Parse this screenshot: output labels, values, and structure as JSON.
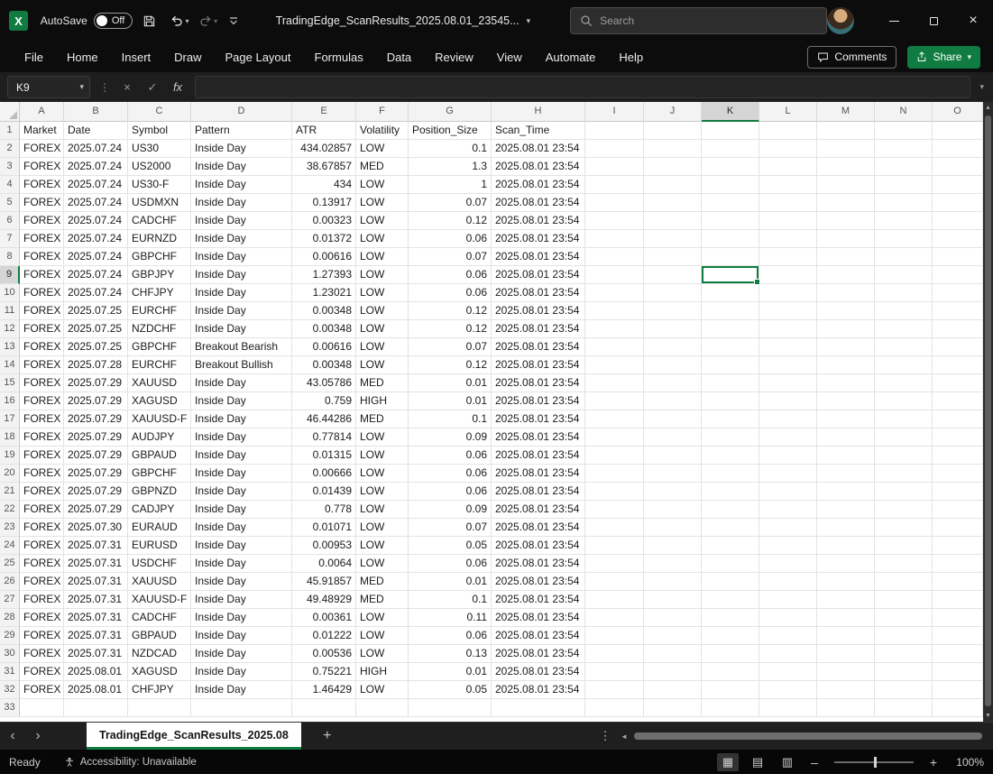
{
  "window": {
    "app": "Excel",
    "autosave_label": "AutoSave",
    "autosave_state": "Off",
    "document_title": "TradingEdge_ScanResults_2025.08.01_23545...",
    "search_placeholder": "Search"
  },
  "ribbon": {
    "tabs": [
      "File",
      "Home",
      "Insert",
      "Draw",
      "Page Layout",
      "Formulas",
      "Data",
      "Review",
      "View",
      "Automate",
      "Help"
    ],
    "comments_label": "Comments",
    "share_label": "Share"
  },
  "formula_bar": {
    "name_box_value": "K9",
    "fx_label": "fx",
    "formula_value": ""
  },
  "grid": {
    "columns": [
      "A",
      "B",
      "C",
      "D",
      "E",
      "F",
      "G",
      "H",
      "I",
      "J",
      "K",
      "L",
      "M",
      "N",
      "O"
    ],
    "selected_cell": "K9",
    "selected_column": "K",
    "selected_row": 9,
    "total_rows": 33,
    "header_row": [
      "Market",
      "Date",
      "Symbol",
      "Pattern",
      "ATR",
      "Volatility",
      "Position_Size",
      "Scan_Time"
    ],
    "rows": [
      [
        "FOREX",
        "2025.07.24",
        "US30",
        "Inside Day",
        "434.02857",
        "LOW",
        "0.1",
        "2025.08.01 23:54"
      ],
      [
        "FOREX",
        "2025.07.24",
        "US2000",
        "Inside Day",
        "38.67857",
        "MED",
        "1.3",
        "2025.08.01 23:54"
      ],
      [
        "FOREX",
        "2025.07.24",
        "US30-F",
        "Inside Day",
        "434",
        "LOW",
        "1",
        "2025.08.01 23:54"
      ],
      [
        "FOREX",
        "2025.07.24",
        "USDMXN",
        "Inside Day",
        "0.13917",
        "LOW",
        "0.07",
        "2025.08.01 23:54"
      ],
      [
        "FOREX",
        "2025.07.24",
        "CADCHF",
        "Inside Day",
        "0.00323",
        "LOW",
        "0.12",
        "2025.08.01 23:54"
      ],
      [
        "FOREX",
        "2025.07.24",
        "EURNZD",
        "Inside Day",
        "0.01372",
        "LOW",
        "0.06",
        "2025.08.01 23:54"
      ],
      [
        "FOREX",
        "2025.07.24",
        "GBPCHF",
        "Inside Day",
        "0.00616",
        "LOW",
        "0.07",
        "2025.08.01 23:54"
      ],
      [
        "FOREX",
        "2025.07.24",
        "GBPJPY",
        "Inside Day",
        "1.27393",
        "LOW",
        "0.06",
        "2025.08.01 23:54"
      ],
      [
        "FOREX",
        "2025.07.24",
        "CHFJPY",
        "Inside Day",
        "1.23021",
        "LOW",
        "0.06",
        "2025.08.01 23:54"
      ],
      [
        "FOREX",
        "2025.07.25",
        "EURCHF",
        "Inside Day",
        "0.00348",
        "LOW",
        "0.12",
        "2025.08.01 23:54"
      ],
      [
        "FOREX",
        "2025.07.25",
        "NZDCHF",
        "Inside Day",
        "0.00348",
        "LOW",
        "0.12",
        "2025.08.01 23:54"
      ],
      [
        "FOREX",
        "2025.07.25",
        "GBPCHF",
        "Breakout Bearish",
        "0.00616",
        "LOW",
        "0.07",
        "2025.08.01 23:54"
      ],
      [
        "FOREX",
        "2025.07.28",
        "EURCHF",
        "Breakout Bullish",
        "0.00348",
        "LOW",
        "0.12",
        "2025.08.01 23:54"
      ],
      [
        "FOREX",
        "2025.07.29",
        "XAUUSD",
        "Inside Day",
        "43.05786",
        "MED",
        "0.01",
        "2025.08.01 23:54"
      ],
      [
        "FOREX",
        "2025.07.29",
        "XAGUSD",
        "Inside Day",
        "0.759",
        "HIGH",
        "0.01",
        "2025.08.01 23:54"
      ],
      [
        "FOREX",
        "2025.07.29",
        "XAUUSD-F",
        "Inside Day",
        "46.44286",
        "MED",
        "0.1",
        "2025.08.01 23:54"
      ],
      [
        "FOREX",
        "2025.07.29",
        "AUDJPY",
        "Inside Day",
        "0.77814",
        "LOW",
        "0.09",
        "2025.08.01 23:54"
      ],
      [
        "FOREX",
        "2025.07.29",
        "GBPAUD",
        "Inside Day",
        "0.01315",
        "LOW",
        "0.06",
        "2025.08.01 23:54"
      ],
      [
        "FOREX",
        "2025.07.29",
        "GBPCHF",
        "Inside Day",
        "0.00666",
        "LOW",
        "0.06",
        "2025.08.01 23:54"
      ],
      [
        "FOREX",
        "2025.07.29",
        "GBPNZD",
        "Inside Day",
        "0.01439",
        "LOW",
        "0.06",
        "2025.08.01 23:54"
      ],
      [
        "FOREX",
        "2025.07.29",
        "CADJPY",
        "Inside Day",
        "0.778",
        "LOW",
        "0.09",
        "2025.08.01 23:54"
      ],
      [
        "FOREX",
        "2025.07.30",
        "EURAUD",
        "Inside Day",
        "0.01071",
        "LOW",
        "0.07",
        "2025.08.01 23:54"
      ],
      [
        "FOREX",
        "2025.07.31",
        "EURUSD",
        "Inside Day",
        "0.00953",
        "LOW",
        "0.05",
        "2025.08.01 23:54"
      ],
      [
        "FOREX",
        "2025.07.31",
        "USDCHF",
        "Inside Day",
        "0.0064",
        "LOW",
        "0.06",
        "2025.08.01 23:54"
      ],
      [
        "FOREX",
        "2025.07.31",
        "XAUUSD",
        "Inside Day",
        "45.91857",
        "MED",
        "0.01",
        "2025.08.01 23:54"
      ],
      [
        "FOREX",
        "2025.07.31",
        "XAUUSD-F",
        "Inside Day",
        "49.48929",
        "MED",
        "0.1",
        "2025.08.01 23:54"
      ],
      [
        "FOREX",
        "2025.07.31",
        "CADCHF",
        "Inside Day",
        "0.00361",
        "LOW",
        "0.11",
        "2025.08.01 23:54"
      ],
      [
        "FOREX",
        "2025.07.31",
        "GBPAUD",
        "Inside Day",
        "0.01222",
        "LOW",
        "0.06",
        "2025.08.01 23:54"
      ],
      [
        "FOREX",
        "2025.07.31",
        "NZDCAD",
        "Inside Day",
        "0.00536",
        "LOW",
        "0.13",
        "2025.08.01 23:54"
      ],
      [
        "FOREX",
        "2025.08.01",
        "XAGUSD",
        "Inside Day",
        "0.75221",
        "HIGH",
        "0.01",
        "2025.08.01 23:54"
      ],
      [
        "FOREX",
        "2025.08.01",
        "CHFJPY",
        "Inside Day",
        "1.46429",
        "LOW",
        "0.05",
        "2025.08.01 23:54"
      ]
    ]
  },
  "sheet_bar": {
    "active_tab": "TradingEdge_ScanResults_2025.08"
  },
  "status_bar": {
    "mode": "Ready",
    "accessibility": "Accessibility: Unavailable",
    "zoom_level": "100%"
  },
  "colors": {
    "accent_green": "#107C41",
    "selection_border": "#107C41"
  }
}
